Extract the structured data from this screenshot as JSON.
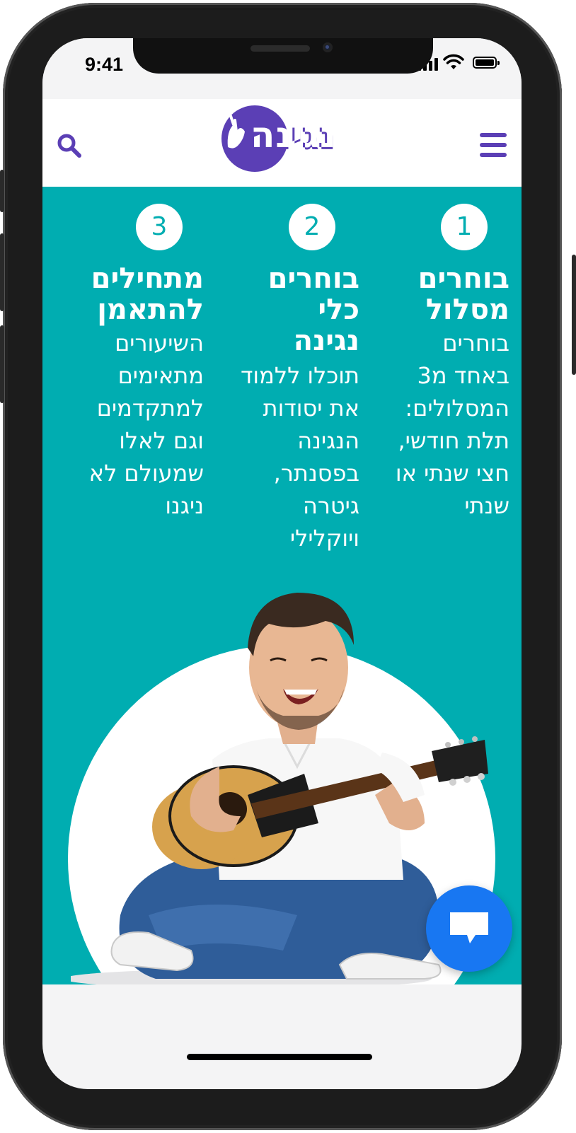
{
  "status_bar": {
    "time": "9:41"
  },
  "header": {
    "logo_text": "נגינה"
  },
  "steps": [
    {
      "number": "1",
      "title": "בוחרים\nמסלול",
      "body": "בוחרים\nבאחד מ3\nהמסלולים:\nתלת חודשי,\nחצי שנתי או\nשנתי"
    },
    {
      "number": "2",
      "title": "בוחרים\nכלי\nנגינה",
      "body": "תוכלו ללמוד\nאת יסודות\nהנגינה\nבפסנתר,\nגיטרה\nויוקלילי"
    },
    {
      "number": "3",
      "title": "מתחילים\nלהתאמן",
      "body": "השיעורים\nמתאימים\nלמתקדמים\nוגם לאלו\nשמעולם לא\nניגנו"
    }
  ],
  "colors": {
    "teal": "#00adb1",
    "brand_purple": "#5b3fb5",
    "chat_blue": "#1877f2"
  },
  "icons": {
    "search": "search-icon",
    "menu": "hamburger-menu-icon",
    "chat": "chat-bubble-icon"
  }
}
